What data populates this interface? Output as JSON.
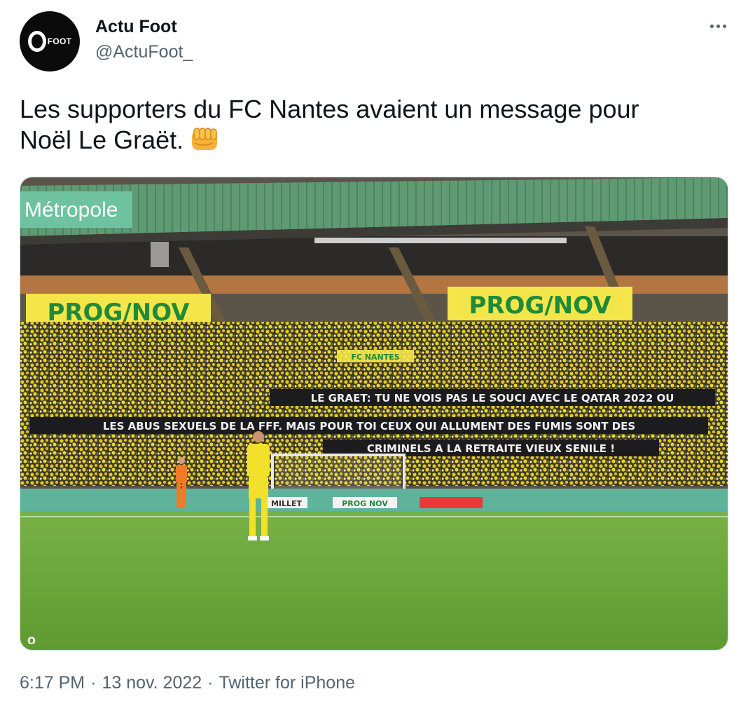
{
  "tweet": {
    "author": {
      "display_name": "Actu Foot",
      "handle": "@ActuFoot_",
      "avatar_text": "FOOT"
    },
    "text_line1": "Les supporters du FC Nantes avaient un message pour",
    "text_line2": "Noël Le Graët.",
    "emoji": "oncoming-fist-emoji",
    "media": {
      "sponsor_sign": "Métropole",
      "banner_left": "PROG/NOV",
      "banner_right": "PROG/NOV",
      "banner_small": "FC NANTES",
      "tifo_line1": "LE GRAET: TU NE VOIS PAS LE SOUCI AVEC LE QATAR 2022 OU",
      "tifo_line2": "LES ABUS SEXUELS DE LA FFF. MAIS POUR TOI CEUX QUI ALLUMENT DES FUMIS SONT DES",
      "tifo_line3": "CRIMINELS A LA RETRAITE VIEUX SENILE !",
      "board_millet": "MILLET",
      "board_prog": "PROG NOV",
      "watermark": "O",
      "colors": {
        "pitch": "#6aa63a",
        "roof": "#5f9a72",
        "crowd": "#e0c020",
        "banner": "#f4e64a",
        "banner_text": "#1f8a3a"
      }
    },
    "time": "6:17 PM",
    "separator": "·",
    "date": "13 nov. 2022",
    "source": "Twitter for iPhone"
  }
}
